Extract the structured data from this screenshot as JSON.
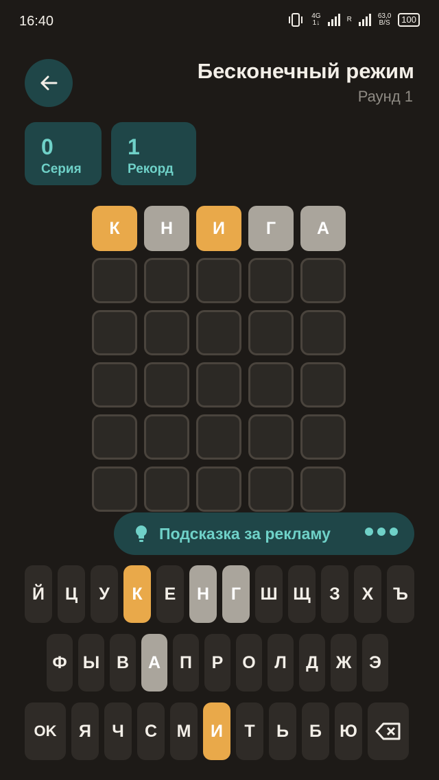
{
  "status": {
    "time": "16:40",
    "net": "4G",
    "net2": "1↓",
    "r": "R",
    "speed": "63,0",
    "speed_unit": "B/S",
    "battery": "100"
  },
  "header": {
    "title": "Бесконечный режим",
    "subtitle": "Раунд 1"
  },
  "stats": [
    {
      "value": "0",
      "label": "Серия"
    },
    {
      "value": "1",
      "label": "Рекорд"
    }
  ],
  "board": {
    "rows": [
      [
        {
          "l": "К",
          "s": "present"
        },
        {
          "l": "Н",
          "s": "absent"
        },
        {
          "l": "И",
          "s": "present"
        },
        {
          "l": "Г",
          "s": "absent"
        },
        {
          "l": "А",
          "s": "absent"
        }
      ],
      [
        {
          "l": "",
          "s": "empty"
        },
        {
          "l": "",
          "s": "empty"
        },
        {
          "l": "",
          "s": "empty"
        },
        {
          "l": "",
          "s": "empty"
        },
        {
          "l": "",
          "s": "empty"
        }
      ],
      [
        {
          "l": "",
          "s": "empty"
        },
        {
          "l": "",
          "s": "empty"
        },
        {
          "l": "",
          "s": "empty"
        },
        {
          "l": "",
          "s": "empty"
        },
        {
          "l": "",
          "s": "empty"
        }
      ],
      [
        {
          "l": "",
          "s": "empty"
        },
        {
          "l": "",
          "s": "empty"
        },
        {
          "l": "",
          "s": "empty"
        },
        {
          "l": "",
          "s": "empty"
        },
        {
          "l": "",
          "s": "empty"
        }
      ],
      [
        {
          "l": "",
          "s": "empty"
        },
        {
          "l": "",
          "s": "empty"
        },
        {
          "l": "",
          "s": "empty"
        },
        {
          "l": "",
          "s": "empty"
        },
        {
          "l": "",
          "s": "empty"
        }
      ],
      [
        {
          "l": "",
          "s": "empty"
        },
        {
          "l": "",
          "s": "empty"
        },
        {
          "l": "",
          "s": "empty"
        },
        {
          "l": "",
          "s": "empty"
        },
        {
          "l": "",
          "s": "empty"
        }
      ]
    ]
  },
  "hint": {
    "label": "Подсказка за рекламу"
  },
  "keyboard": {
    "rows": [
      [
        {
          "k": "Й"
        },
        {
          "k": "Ц"
        },
        {
          "k": "У"
        },
        {
          "k": "К",
          "s": "present"
        },
        {
          "k": "Е"
        },
        {
          "k": "Н",
          "s": "absent"
        },
        {
          "k": "Г",
          "s": "absent"
        },
        {
          "k": "Ш"
        },
        {
          "k": "Щ"
        },
        {
          "k": "З"
        },
        {
          "k": "Х"
        },
        {
          "k": "Ъ"
        }
      ],
      [
        {
          "k": "Ф"
        },
        {
          "k": "Ы"
        },
        {
          "k": "В"
        },
        {
          "k": "А",
          "s": "absent"
        },
        {
          "k": "П"
        },
        {
          "k": "Р"
        },
        {
          "k": "О"
        },
        {
          "k": "Л"
        },
        {
          "k": "Д"
        },
        {
          "k": "Ж"
        },
        {
          "k": "Э"
        }
      ],
      [
        {
          "k": "OK",
          "special": "enter"
        },
        {
          "k": "Я"
        },
        {
          "k": "Ч"
        },
        {
          "k": "С"
        },
        {
          "k": "М"
        },
        {
          "k": "И",
          "s": "present"
        },
        {
          "k": "Т"
        },
        {
          "k": "Ь"
        },
        {
          "k": "Б"
        },
        {
          "k": "Ю"
        },
        {
          "k": "",
          "special": "backspace"
        }
      ]
    ]
  },
  "colors": {
    "present": "#e9a94a",
    "absent": "#aaa59c",
    "accent": "#6fd1c8",
    "panel": "#1f4648"
  }
}
